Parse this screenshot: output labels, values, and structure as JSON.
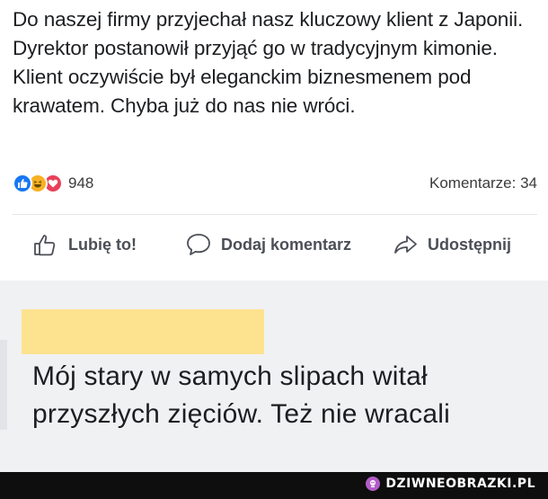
{
  "post": {
    "text": "Do naszej firmy przyjechał nasz kluczowy klient z Japonii. Dyrektor postanowił przyjąć go w tradycyjnym kimonie. Klient oczywiście był eleganckim biznesmenem pod krawatem. Chyba już do nas nie wróci.",
    "reactions": {
      "icons": [
        "like-reaction",
        "haha-reaction",
        "love-reaction"
      ],
      "count": "948"
    },
    "comments_label": "Komentarze: 34"
  },
  "actions": {
    "like": "Lubię to!",
    "comment": "Dodaj komentarz",
    "share": "Udostępnij"
  },
  "comment": {
    "text": "Mój stary w samych slipach witał przyszłych zięciów. Też nie wracali"
  },
  "footer": {
    "brand": "DZIWNEOBRAZKI.PL"
  },
  "colors": {
    "like": "#1877f2",
    "haha": "#f7b125",
    "love": "#e9405a",
    "redaction": "#fde28f",
    "footer_bg": "#0e0e0e"
  }
}
